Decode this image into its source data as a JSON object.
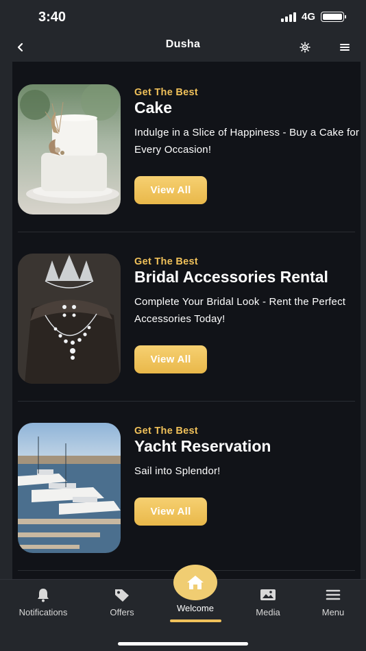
{
  "status": {
    "time": "3:40",
    "network": "4G"
  },
  "header": {
    "title": "Dusha"
  },
  "cards": [
    {
      "eyebrow": "Get The Best",
      "title": "Cake",
      "description": "Indulge in a Slice of Happiness - Buy a Cake for Every Occasion!",
      "button": "View All",
      "image": "wedding-cake-photo"
    },
    {
      "eyebrow": "Get The Best",
      "title": "Bridal Accessories Rental",
      "description": "Complete Your Bridal Look - Rent the Perfect Accessories Today!",
      "button": "View All",
      "image": "bridal-jewelry-photo"
    },
    {
      "eyebrow": "Get The Best",
      "title": "Yacht Reservation",
      "description": "Sail into Splendor!",
      "button": "View All",
      "image": "yacht-marina-photo"
    }
  ],
  "nav": {
    "items": [
      {
        "label": "Notifications",
        "icon": "bell-icon"
      },
      {
        "label": "Offers",
        "icon": "tag-icon"
      },
      {
        "label": "Welcome",
        "icon": "home-icon",
        "active": true
      },
      {
        "label": "Media",
        "icon": "image-icon"
      },
      {
        "label": "Menu",
        "icon": "hamburger-icon"
      }
    ]
  },
  "colors": {
    "background": "#24272c",
    "content": "#111318",
    "accent": "#f0c15a"
  }
}
